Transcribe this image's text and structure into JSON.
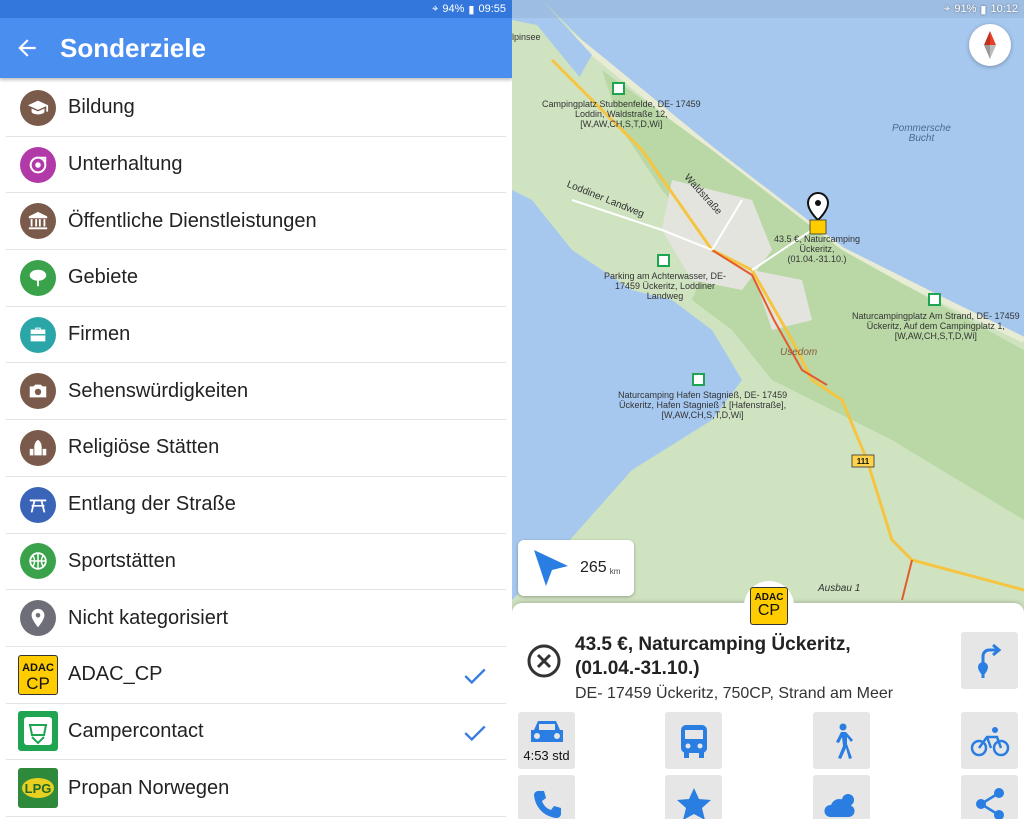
{
  "left": {
    "status": {
      "battery": "94%",
      "time": "09:55"
    },
    "title": "Sonderziele",
    "items": [
      {
        "label": "Bildung",
        "icon": "graduation-cap-icon",
        "color": "#7a5a4a",
        "checked": false
      },
      {
        "label": "Unterhaltung",
        "icon": "entertainment-icon",
        "color": "#b23aa8",
        "checked": false
      },
      {
        "label": "Öffentliche Dienstleistungen",
        "icon": "public-building-icon",
        "color": "#7a5a4a",
        "checked": false
      },
      {
        "label": "Gebiete",
        "icon": "tree-icon",
        "color": "#3aa24a",
        "checked": false
      },
      {
        "label": "Firmen",
        "icon": "briefcase-icon",
        "color": "#2aa6a8",
        "checked": false
      },
      {
        "label": "Sehenswürdigkeiten",
        "icon": "camera-icon",
        "color": "#7a5a4a",
        "checked": false
      },
      {
        "label": "Religiöse Stätten",
        "icon": "church-icon",
        "color": "#7a5a4a",
        "checked": false
      },
      {
        "label": "Entlang der Straße",
        "icon": "picnic-table-icon",
        "color": "#3a64b8",
        "checked": false
      },
      {
        "label": "Sportstätten",
        "icon": "basketball-icon",
        "color": "#3aa24a",
        "checked": false
      },
      {
        "label": "Nicht kategorisiert",
        "icon": "pin-icon",
        "color": "#6e6e78",
        "checked": false
      },
      {
        "label": "ADAC_CP",
        "icon": "adac-cp-icon",
        "checked": true
      },
      {
        "label": "Campercontact",
        "icon": "campercontact-icon",
        "checked": true
      },
      {
        "label": "Propan Norwegen",
        "icon": "lpg-icon",
        "checked": false
      }
    ],
    "check_color": "#3a7de0"
  },
  "right": {
    "status": {
      "battery": "91%",
      "time": "10:12"
    },
    "map_labels": {
      "top_left": "lpinsee",
      "bay": "Pommersche\nBucht",
      "road1": "Loddiner Landweg",
      "road2": "Waldstraße",
      "town": "Usedom",
      "road_number": "111",
      "ausbau": "Ausbau 1",
      "poi1": "Campingplatz Stubbenfelde, DE- 17459\nLoddin, Waldstraße 12,\n[W,AW,CH,S,T,D,Wi]",
      "poi2": "43.5 €, Naturcamping\nÜckeritz,\n(01.04.-31.10.)",
      "poi3": "Parking am Achterwasser, DE-\n17459 Ückeritz, Loddiner\nLandweg",
      "poi4": "Naturcampingplatz Am Strand, DE- 17459\nÜckeritz, Auf dem Campingplatz 1,\n[W,AW,CH,S,T,D,Wi]",
      "poi5": "Naturcamping Hafen Stagnieß, DE- 17459\nÜckeritz, Hafen Stagnieß 1 [Hafenstraße],\n[W,AW,CH,S,T,D,Wi]"
    },
    "distance": {
      "value": "265",
      "unit": "km"
    },
    "adac_badge": {
      "top": "ADAC",
      "bottom": "CP"
    },
    "detail": {
      "title": "43.5 €, Naturcamping Ückeritz, (01.04.-31.10.)",
      "address": "DE- 17459 Ückeritz, 750CP, Strand am Meer"
    },
    "transport": {
      "car_time": "4:53 std"
    },
    "accent": "#2a7de1"
  }
}
